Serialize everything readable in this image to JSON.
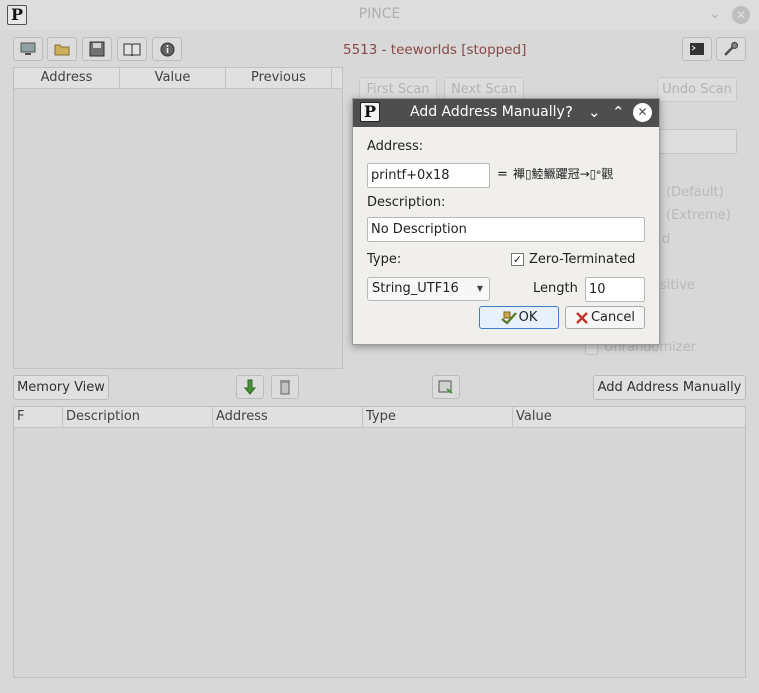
{
  "window": {
    "title": "PINCE",
    "process_title": "5513 - teeworlds  [stopped]"
  },
  "toolbar": {
    "icons": [
      "computer-icon",
      "folder-icon",
      "save-icon",
      "book-icon",
      "info-icon",
      "terminal-icon",
      "wrench-icon"
    ]
  },
  "scan_table": {
    "columns": [
      "Address",
      "Value",
      "Previous"
    ]
  },
  "scan_buttons": {
    "first_scan": "First Scan",
    "next_scan": "Next Scan",
    "undo_scan": "Undo Scan"
  },
  "scan_options": {
    "default": "(Default)",
    "extreme": "(Extreme)",
    "partial_d": "d",
    "partial_sitive": "sitive",
    "unrandomizer": "Unrandomizer"
  },
  "bottom_bar": {
    "memory_view": "Memory View",
    "add_manually": "Add Address Manually"
  },
  "address_table": {
    "columns": [
      "F",
      "Description",
      "Address",
      "Type",
      "Value"
    ]
  },
  "dialog": {
    "title": "Add Address Manually",
    "controls": {
      "help": "?",
      "minimize": "⌄",
      "maximize": "⌃",
      "close": "✕"
    },
    "address_label": "Address:",
    "address_value": "printf+0x18",
    "equals": "=",
    "address_result": "襌▯鯥鱖躣冠→▯ᵉ觀",
    "description_label": "Description:",
    "description_value": "No Description",
    "type_label": "Type:",
    "zero_terminated_label": "Zero-Terminated",
    "zero_terminated_checked": true,
    "type_value": "String_UTF16",
    "length_label": "Length",
    "length_value": "10",
    "ok_label": "OK",
    "cancel_label": "Cancel"
  },
  "colors": {
    "dialog_title_bg": "#4e4e4e",
    "process_title": "#8f4b4b",
    "default_button_border": "#3d7dc7"
  }
}
